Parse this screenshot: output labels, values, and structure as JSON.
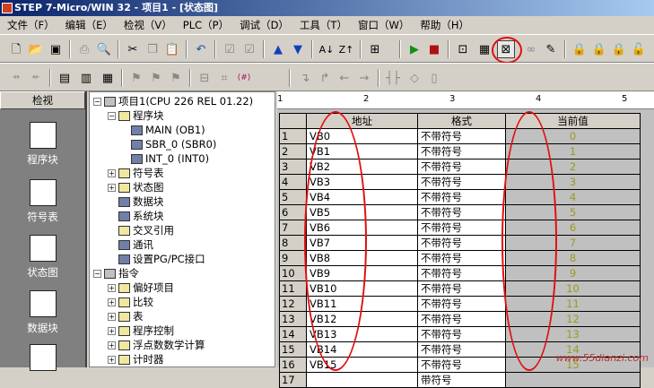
{
  "window": {
    "title": "STEP 7-Micro/WIN 32 - 项目1 - [状态图]"
  },
  "menu": [
    "文件（F）",
    "编辑（E）",
    "检视（V）",
    "PLC（P）",
    "调试（D）",
    "工具（T）",
    "窗口（W）",
    "帮助（H）"
  ],
  "toolbar1": {
    "icons": [
      "new-icon",
      "open-icon",
      "save-icon",
      "print-icon",
      "print-preview-icon",
      "cut-icon",
      "copy-icon",
      "paste-icon",
      "undo-icon",
      "compile-icon",
      "compile-all-icon",
      "upload-icon",
      "download-icon",
      "sort-ascending-icon",
      "sort-descending-icon",
      "options-icon",
      "run-icon",
      "stop-icon",
      "program-status-icon",
      "status-chart-icon",
      "trend-icon",
      "write-force-icon",
      "lock-icon",
      "unlock-icon",
      "single-read-icon",
      "force-icon",
      "unforce-icon"
    ]
  },
  "toolbar2": {
    "icons": [
      "insert-row-icon",
      "delete-row-icon",
      "view-ladder-icon",
      "view-stl-icon",
      "view-fbd-icon",
      "bookmark-next-icon",
      "bookmark-prev-icon",
      "bookmark-clear-icon",
      "label-icon",
      "symbols-icon",
      "line-down-icon",
      "line-up-icon",
      "line-left-icon",
      "line-right-icon",
      "contact-icon",
      "coil-icon",
      "box-icon"
    ]
  },
  "navbar": {
    "title": "检视",
    "items": [
      {
        "label": "程序块",
        "icon": "program-block-icon"
      },
      {
        "label": "符号表",
        "icon": "symbol-table-icon"
      },
      {
        "label": "状态图",
        "icon": "status-chart-icon"
      },
      {
        "label": "数据块",
        "icon": "data-block-icon"
      }
    ]
  },
  "tree": {
    "project": "项目1(CPU 226 REL 01.22)",
    "program_block": "程序块",
    "main": "MAIN (OB1)",
    "sbr": "SBR_0 (SBR0)",
    "int": "INT_0 (INT0)",
    "symbol_table": "符号表",
    "status_chart": "状态图",
    "data_block": "数据块",
    "system_block": "系统块",
    "cross_ref": "交叉引用",
    "comm": "通讯",
    "pg_pc": "设置PG/PC接口",
    "instructions": "指令",
    "favorites": "偏好项目",
    "compare": "比较",
    "table": "表",
    "program_control": "程序控制",
    "float_math": "浮点数数学计算",
    "counter": "计时器"
  },
  "ruler": {
    "marks": [
      "1",
      "2",
      "3",
      "4",
      "5"
    ]
  },
  "grid": {
    "headers": {
      "address": "地址",
      "format": "格式",
      "value": "当前值"
    },
    "rows": [
      {
        "n": "1",
        "addr": "VB0",
        "fmt": "不带符号",
        "val": "0"
      },
      {
        "n": "2",
        "addr": "VB1",
        "fmt": "不带符号",
        "val": "1"
      },
      {
        "n": "3",
        "addr": "VB2",
        "fmt": "不带符号",
        "val": "2"
      },
      {
        "n": "4",
        "addr": "VB3",
        "fmt": "不带符号",
        "val": "3"
      },
      {
        "n": "5",
        "addr": "VB4",
        "fmt": "不带符号",
        "val": "4"
      },
      {
        "n": "6",
        "addr": "VB5",
        "fmt": "不带符号",
        "val": "5"
      },
      {
        "n": "7",
        "addr": "VB6",
        "fmt": "不带符号",
        "val": "6"
      },
      {
        "n": "8",
        "addr": "VB7",
        "fmt": "不带符号",
        "val": "7"
      },
      {
        "n": "9",
        "addr": "VB8",
        "fmt": "不带符号",
        "val": "8"
      },
      {
        "n": "10",
        "addr": "VB9",
        "fmt": "不带符号",
        "val": "9"
      },
      {
        "n": "11",
        "addr": "VB10",
        "fmt": "不带符号",
        "val": "10"
      },
      {
        "n": "12",
        "addr": "VB11",
        "fmt": "不带符号",
        "val": "11"
      },
      {
        "n": "13",
        "addr": "VB12",
        "fmt": "不带符号",
        "val": "12"
      },
      {
        "n": "14",
        "addr": "VB13",
        "fmt": "不带符号",
        "val": "13"
      },
      {
        "n": "15",
        "addr": "VB14",
        "fmt": "不带符号",
        "val": "14"
      },
      {
        "n": "16",
        "addr": "VB15",
        "fmt": "不带符号",
        "val": "15"
      },
      {
        "n": "17",
        "addr": "",
        "fmt": "带符号",
        "val": ""
      }
    ]
  },
  "watermark": "www.55dianzi.com",
  "colors": {
    "annotation": "#e01010",
    "value_text": "#9a9a20",
    "title_bar": "#0a246a"
  }
}
